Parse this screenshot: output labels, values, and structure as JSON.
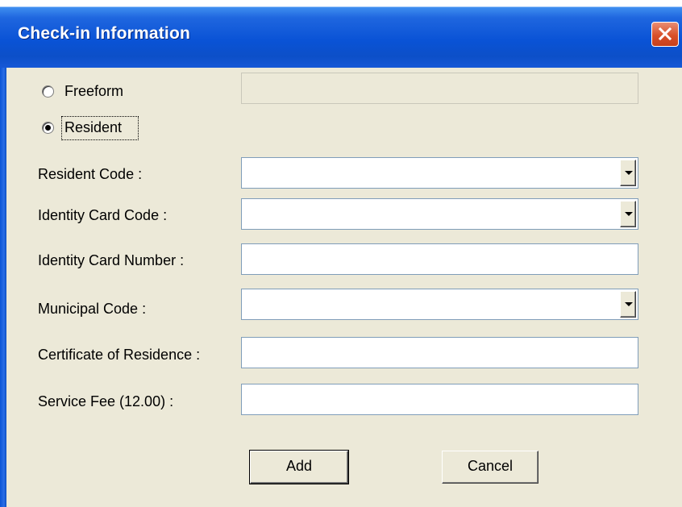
{
  "window": {
    "title": "Check-in Information"
  },
  "mode": {
    "freeform_label": "Freeform",
    "resident_label": "Resident",
    "selected": "Resident",
    "freeform_value": ""
  },
  "fields": {
    "resident_code": {
      "label": "Resident Code :",
      "value": ""
    },
    "identity_card_code": {
      "label": "Identity Card Code :",
      "value": ""
    },
    "identity_card_number": {
      "label": "Identity Card Number :",
      "value": ""
    },
    "municipal_code": {
      "label": "Municipal Code :",
      "value": ""
    },
    "certificate_of_residence": {
      "label": "Certificate of Residence :",
      "value": ""
    },
    "service_fee": {
      "label": "Service Fee (12.00) :",
      "value": ""
    }
  },
  "buttons": {
    "add": "Add",
    "cancel": "Cancel"
  },
  "icons": {
    "close": "close-icon",
    "dropdown": "chevron-down-icon"
  }
}
